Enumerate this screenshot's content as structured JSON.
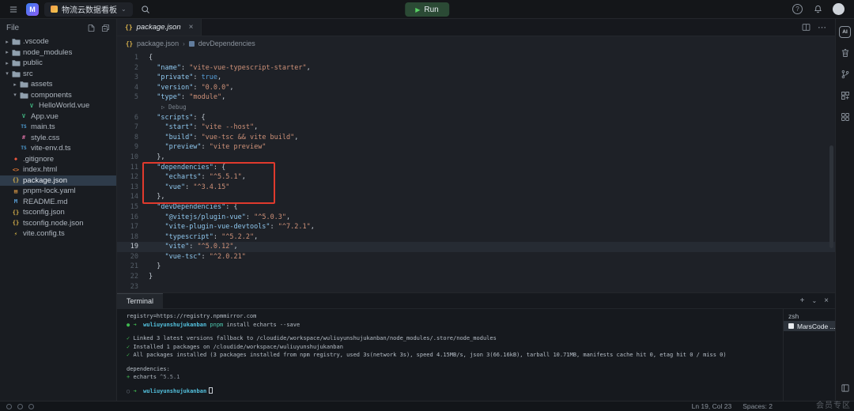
{
  "titlebar": {
    "project": "物流云数据看板",
    "run": "Run"
  },
  "icons": {
    "vue": "V",
    "ts": "TS",
    "css": "#",
    "json": "{}",
    "html": "<>",
    "git": "◆",
    "yaml": "▤",
    "md": "M",
    "vite": "⚡"
  },
  "sidebar": {
    "title": "File",
    "tree": [
      {
        "label": ".vscode",
        "kind": "folder",
        "level": 0,
        "open": false
      },
      {
        "label": "node_modules",
        "kind": "folder",
        "level": 0,
        "open": false
      },
      {
        "label": "public",
        "kind": "folder",
        "level": 0,
        "open": false
      },
      {
        "label": "src",
        "kind": "folder",
        "level": 0,
        "open": true
      },
      {
        "label": "assets",
        "kind": "folder",
        "level": 1,
        "open": false
      },
      {
        "label": "components",
        "kind": "folder",
        "level": 1,
        "open": true
      },
      {
        "label": "HelloWorld.vue",
        "kind": "vue",
        "level": 2
      },
      {
        "label": "App.vue",
        "kind": "vue",
        "level": 1
      },
      {
        "label": "main.ts",
        "kind": "ts",
        "level": 1
      },
      {
        "label": "style.css",
        "kind": "css",
        "level": 1
      },
      {
        "label": "vite-env.d.ts",
        "kind": "ts",
        "level": 1
      },
      {
        "label": ".gitignore",
        "kind": "git",
        "level": 0
      },
      {
        "label": "index.html",
        "kind": "html",
        "level": 0
      },
      {
        "label": "package.json",
        "kind": "json",
        "level": 0,
        "selected": true
      },
      {
        "label": "pnpm-lock.yaml",
        "kind": "yaml",
        "level": 0
      },
      {
        "label": "README.md",
        "kind": "md",
        "level": 0
      },
      {
        "label": "tsconfig.json",
        "kind": "json",
        "level": 0
      },
      {
        "label": "tsconfig.node.json",
        "kind": "json",
        "level": 0
      },
      {
        "label": "vite.config.ts",
        "kind": "vite",
        "level": 0
      }
    ]
  },
  "editor": {
    "tab": "package.json",
    "breadcrumb": {
      "file": "package.json",
      "symbol": "devDependencies"
    },
    "codelens": "Debug",
    "lines": [
      {
        "n": 1,
        "t": [
          [
            "p",
            "{"
          ]
        ]
      },
      {
        "n": 2,
        "t": [
          [
            "p",
            "  "
          ],
          [
            "k",
            "\"name\""
          ],
          [
            "p",
            ": "
          ],
          [
            "s",
            "\"vite-vue-typescript-starter\""
          ],
          [
            "p",
            ","
          ]
        ]
      },
      {
        "n": 3,
        "t": [
          [
            "p",
            "  "
          ],
          [
            "k",
            "\"private\""
          ],
          [
            "p",
            ": "
          ],
          [
            "b",
            "true"
          ],
          [
            "p",
            ","
          ]
        ]
      },
      {
        "n": 4,
        "t": [
          [
            "p",
            "  "
          ],
          [
            "k",
            "\"version\""
          ],
          [
            "p",
            ": "
          ],
          [
            "s",
            "\"0.0.0\""
          ],
          [
            "p",
            ","
          ]
        ]
      },
      {
        "n": 5,
        "t": [
          [
            "p",
            "  "
          ],
          [
            "k",
            "\"type\""
          ],
          [
            "p",
            ": "
          ],
          [
            "s",
            "\"module\""
          ],
          [
            "p",
            ","
          ]
        ]
      },
      {
        "lens": true
      },
      {
        "n": 6,
        "t": [
          [
            "p",
            "  "
          ],
          [
            "k",
            "\"scripts\""
          ],
          [
            "p",
            ": {"
          ]
        ]
      },
      {
        "n": 7,
        "t": [
          [
            "p",
            "    "
          ],
          [
            "k",
            "\"start\""
          ],
          [
            "p",
            ": "
          ],
          [
            "s",
            "\"vite --host\""
          ],
          [
            "p",
            ","
          ]
        ]
      },
      {
        "n": 8,
        "t": [
          [
            "p",
            "    "
          ],
          [
            "k",
            "\"build\""
          ],
          [
            "p",
            ": "
          ],
          [
            "s",
            "\"vue-tsc && vite build\""
          ],
          [
            "p",
            ","
          ]
        ]
      },
      {
        "n": 9,
        "t": [
          [
            "p",
            "    "
          ],
          [
            "k",
            "\"preview\""
          ],
          [
            "p",
            ": "
          ],
          [
            "s",
            "\"vite preview\""
          ]
        ]
      },
      {
        "n": 10,
        "t": [
          [
            "p",
            "  },"
          ]
        ]
      },
      {
        "n": 11,
        "t": [
          [
            "p",
            "  "
          ],
          [
            "k",
            "\"dependencies\""
          ],
          [
            "p",
            ": {"
          ]
        ]
      },
      {
        "n": 12,
        "t": [
          [
            "p",
            "    "
          ],
          [
            "k",
            "\"echarts\""
          ],
          [
            "p",
            ": "
          ],
          [
            "s",
            "\"^5.5.1\""
          ],
          [
            "p",
            ","
          ]
        ]
      },
      {
        "n": 13,
        "t": [
          [
            "p",
            "    "
          ],
          [
            "k",
            "\"vue\""
          ],
          [
            "p",
            ": "
          ],
          [
            "s",
            "\"^3.4.15\""
          ]
        ]
      },
      {
        "n": 14,
        "t": [
          [
            "p",
            "  },"
          ]
        ]
      },
      {
        "n": 15,
        "t": [
          [
            "p",
            "  "
          ],
          [
            "k",
            "\"devDependencies\""
          ],
          [
            "p",
            ": {"
          ]
        ]
      },
      {
        "n": 16,
        "t": [
          [
            "p",
            "    "
          ],
          [
            "k",
            "\"@vitejs/plugin-vue\""
          ],
          [
            "p",
            ": "
          ],
          [
            "s",
            "\"^5.0.3\""
          ],
          [
            "p",
            ","
          ]
        ]
      },
      {
        "n": 17,
        "t": [
          [
            "p",
            "    "
          ],
          [
            "k",
            "\"vite-plugin-vue-devtools\""
          ],
          [
            "p",
            ": "
          ],
          [
            "s",
            "\"^7.2.1\""
          ],
          [
            "p",
            ","
          ]
        ]
      },
      {
        "n": 18,
        "t": [
          [
            "p",
            "    "
          ],
          [
            "k",
            "\"typescript\""
          ],
          [
            "p",
            ": "
          ],
          [
            "s",
            "\"^5.2.2\""
          ],
          [
            "p",
            ","
          ]
        ]
      },
      {
        "n": 19,
        "current": true,
        "t": [
          [
            "p",
            "    "
          ],
          [
            "k",
            "\"vite\""
          ],
          [
            "p",
            ": "
          ],
          [
            "s",
            "\"^5.0.12\""
          ],
          [
            "p",
            ","
          ]
        ]
      },
      {
        "n": 20,
        "t": [
          [
            "p",
            "    "
          ],
          [
            "k",
            "\"vue-tsc\""
          ],
          [
            "p",
            ": "
          ],
          [
            "s",
            "\"^2.0.21\""
          ]
        ]
      },
      {
        "n": 21,
        "t": [
          [
            "p",
            "  }"
          ]
        ]
      },
      {
        "n": 22,
        "t": [
          [
            "p",
            "}"
          ]
        ]
      },
      {
        "n": 23,
        "t": []
      }
    ]
  },
  "terminal": {
    "tab": "Terminal",
    "lines": [
      {
        "t": [
          [
            "d",
            "registry=https://registry.npmmirror.com"
          ]
        ]
      },
      {
        "t": [
          [
            "dot",
            "● "
          ],
          [
            "g",
            "➜  "
          ],
          [
            "cyan",
            "wuliuyunshujukanban"
          ],
          [
            "teal",
            " pnpm "
          ],
          [
            "d",
            "install echarts --save"
          ]
        ]
      },
      {
        "blank": true,
        "t": []
      },
      {
        "t": [
          [
            "g",
            "✓ "
          ],
          [
            "d",
            "Linked 3 latest versions fallback to /cloudide/workspace/wuliuyunshujukanban/node_modules/.store/node_modules"
          ]
        ]
      },
      {
        "t": [
          [
            "g",
            "✓ "
          ],
          [
            "d",
            "Installed 1 packages on /cloudide/workspace/wuliuyunshujukanban"
          ]
        ]
      },
      {
        "t": [
          [
            "g",
            "✓ "
          ],
          [
            "d",
            "All packages installed (3 packages installed from npm registry, used 3s(network 3s), speed 4.15MB/s, json 3(66.16kB), tarball 10.71MB, manifests cache hit 0, etag hit 0 / miss 0)"
          ]
        ]
      },
      {
        "blank": true,
        "t": []
      },
      {
        "t": [
          [
            "d",
            "dependencies:"
          ]
        ]
      },
      {
        "t": [
          [
            "g",
            "+ "
          ],
          [
            "d",
            "echarts "
          ],
          [
            "dim",
            "^5.5.1"
          ]
        ]
      },
      {
        "blank": true,
        "t": []
      },
      {
        "t": [
          [
            "odot",
            "○ "
          ],
          [
            "g",
            "➜  "
          ],
          [
            "cyan",
            "wuliuyunshujukanban"
          ],
          [
            "cursor",
            ""
          ]
        ]
      }
    ],
    "sessions": [
      {
        "label": "zsh",
        "selected": false,
        "icon": false
      },
      {
        "label": "MarsCode ...",
        "selected": true,
        "icon": true
      }
    ]
  },
  "statusbar": {
    "cursor": "Ln 19, Col 23",
    "spaces": "Spaces: 2",
    "watermark": "会员专区"
  }
}
